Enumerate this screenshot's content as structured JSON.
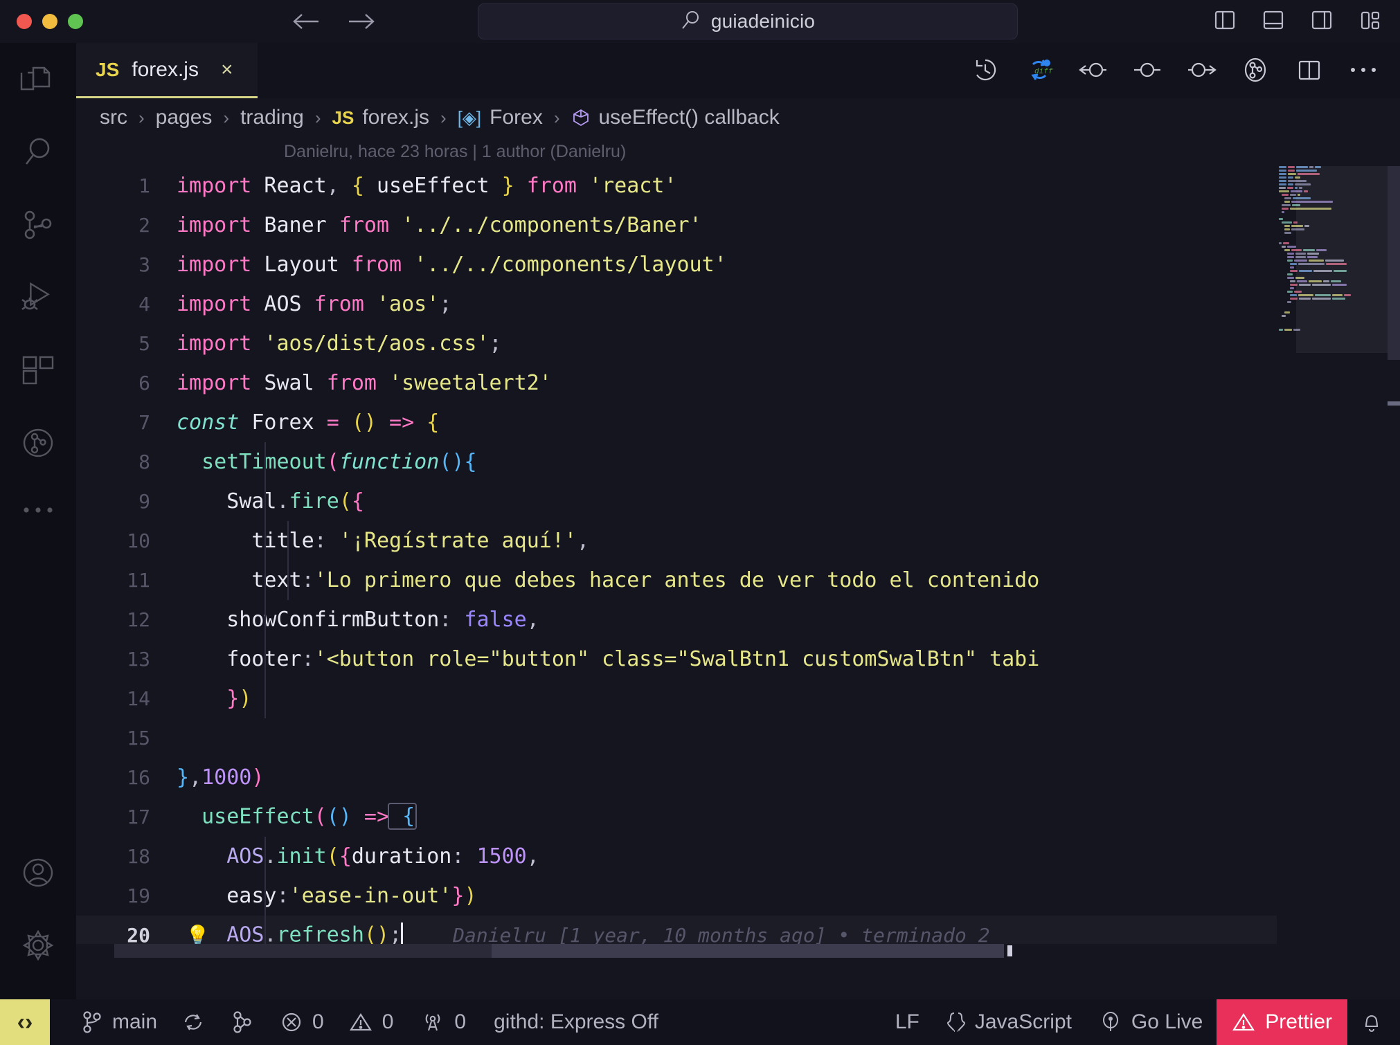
{
  "titlebar": {
    "search_value": "guiadeinicio",
    "search_icon": "search-icon",
    "back_icon": "arrow-left-icon",
    "forward_icon": "arrow-right-icon",
    "layout_buttons": [
      {
        "name": "toggle-primary-sidebar-icon"
      },
      {
        "name": "toggle-panel-icon"
      },
      {
        "name": "toggle-secondary-sidebar-icon"
      },
      {
        "name": "customize-layout-icon"
      }
    ]
  },
  "activitybar": {
    "items": [
      {
        "name": "explorer-icon",
        "label": "Explorer"
      },
      {
        "name": "search-icon",
        "label": "Search"
      },
      {
        "name": "source-control-icon",
        "label": "Source Control"
      },
      {
        "name": "run-and-debug-icon",
        "label": "Run and Debug"
      },
      {
        "name": "extensions-icon",
        "label": "Extensions"
      },
      {
        "name": "git-graph-icon",
        "label": "Git Graph"
      },
      {
        "name": "more-icon",
        "label": "Additional Views"
      }
    ],
    "bottom_items": [
      {
        "name": "accounts-icon",
        "label": "Accounts"
      },
      {
        "name": "settings-gear-icon",
        "label": "Manage"
      }
    ]
  },
  "tab": {
    "icon_label": "JS",
    "filename": "forex.js",
    "close_label": "×"
  },
  "editor_actions": [
    {
      "name": "timeline-history-icon"
    },
    {
      "name": "git-diff-icon"
    },
    {
      "name": "previous-change-icon"
    },
    {
      "name": "current-change-icon"
    },
    {
      "name": "next-change-icon"
    },
    {
      "name": "git-blame-toggle-icon"
    },
    {
      "name": "split-editor-icon"
    },
    {
      "name": "more-actions-icon"
    }
  ],
  "breadcrumb": {
    "items": [
      {
        "label": "src",
        "icon": null
      },
      {
        "label": "pages",
        "icon": null
      },
      {
        "label": "trading",
        "icon": null
      },
      {
        "label": "forex.js",
        "icon": "js-file-icon"
      },
      {
        "label": "Forex",
        "icon": "symbol-variable-icon"
      },
      {
        "label": "useEffect() callback",
        "icon": "symbol-function-icon"
      }
    ],
    "separator": "›"
  },
  "blame_header": "Danielru, hace 23 horas | 1 author (Danielru)",
  "editor": {
    "current_line": 20,
    "inline_blame": "Danielru [1 year, 10 months ago] • terminado 2",
    "lightbulb_icon": "lightbulb-icon",
    "lines": [
      {
        "n": 1,
        "tokens": [
          [
            "t-kw",
            "import"
          ],
          [
            "t-var",
            " React"
          ],
          [
            "t-punc",
            ","
          ],
          [
            "t-b1",
            " {"
          ],
          [
            "t-var",
            " useEffect "
          ],
          [
            "t-b1",
            "}"
          ],
          [
            "t-kw",
            " from"
          ],
          [
            "t-str",
            " 'react'"
          ]
        ]
      },
      {
        "n": 2,
        "tokens": [
          [
            "t-kw",
            "import"
          ],
          [
            "t-var",
            " Baner"
          ],
          [
            "t-kw",
            " from"
          ],
          [
            "t-str",
            " '../../components/Baner'"
          ]
        ]
      },
      {
        "n": 3,
        "tokens": [
          [
            "t-kw",
            "import"
          ],
          [
            "t-var",
            " Layout"
          ],
          [
            "t-kw",
            " from"
          ],
          [
            "t-str",
            " '../../components/layout'"
          ]
        ]
      },
      {
        "n": 4,
        "tokens": [
          [
            "t-kw",
            "import"
          ],
          [
            "t-var",
            " AOS"
          ],
          [
            "t-kw",
            " from"
          ],
          [
            "t-str",
            " 'aos'"
          ],
          [
            "t-punc",
            ";"
          ]
        ]
      },
      {
        "n": 5,
        "tokens": [
          [
            "t-kw",
            "import"
          ],
          [
            "t-str",
            " 'aos/dist/aos.css'"
          ],
          [
            "t-punc",
            ";"
          ]
        ]
      },
      {
        "n": 6,
        "tokens": [
          [
            "t-kw",
            "import"
          ],
          [
            "t-var",
            " Swal"
          ],
          [
            "t-kw",
            " from"
          ],
          [
            "t-str",
            " 'sweetalert2'"
          ]
        ]
      },
      {
        "n": 7,
        "tokens": [
          [
            "t-kw2",
            "const"
          ],
          [
            "t-var",
            " Forex "
          ],
          [
            "t-kw",
            "="
          ],
          [
            "t-b1",
            " ()"
          ],
          [
            "t-kw",
            " =>"
          ],
          [
            "t-b1",
            " {"
          ]
        ]
      },
      {
        "n": 8,
        "tokens": [
          [
            "t-fn",
            "  setTimeout"
          ],
          [
            "t-b2",
            "("
          ],
          [
            "t-fnit",
            "function"
          ],
          [
            "t-b3",
            "()"
          ],
          [
            "t-b3",
            "{"
          ]
        ]
      },
      {
        "n": 9,
        "tokens": [
          [
            "t-var",
            "    Swal"
          ],
          [
            "t-punc",
            "."
          ],
          [
            "t-fn",
            "fire"
          ],
          [
            "t-b1",
            "("
          ],
          [
            "t-b2",
            "{"
          ]
        ]
      },
      {
        "n": 10,
        "tokens": [
          [
            "t-prop",
            "      title"
          ],
          [
            "t-punc",
            ": "
          ],
          [
            "t-str",
            "'¡Regístrate aquí!'"
          ],
          [
            "t-punc",
            ","
          ]
        ]
      },
      {
        "n": 11,
        "tokens": [
          [
            "t-prop",
            "      text"
          ],
          [
            "t-punc",
            ":"
          ],
          [
            "t-str",
            "'Lo primero que debes hacer antes de ver todo el contenido"
          ]
        ]
      },
      {
        "n": 12,
        "tokens": [
          [
            "t-prop",
            "    showConfirmButton"
          ],
          [
            "t-punc",
            ": "
          ],
          [
            "t-bool",
            "false"
          ],
          [
            "t-punc",
            ","
          ]
        ]
      },
      {
        "n": 13,
        "tokens": [
          [
            "t-prop",
            "    footer"
          ],
          [
            "t-punc",
            ":"
          ],
          [
            "t-str",
            "'<button role=\"button\" class=\"SwalBtn1 customSwalBtn\" tabi"
          ]
        ]
      },
      {
        "n": 14,
        "tokens": [
          [
            "t-b2",
            "    }"
          ],
          [
            "t-b1",
            ")"
          ]
        ]
      },
      {
        "n": 15,
        "tokens": []
      },
      {
        "n": 16,
        "tokens": [
          [
            "t-b3",
            "}"
          ],
          [
            "t-punc",
            ","
          ],
          [
            "t-num",
            "1000"
          ],
          [
            "t-b2",
            ")"
          ]
        ]
      },
      {
        "n": 17,
        "tokens": [
          [
            "t-fn",
            "  useEffect"
          ],
          [
            "t-b2",
            "("
          ],
          [
            "t-b3",
            "()"
          ],
          [
            "t-kw",
            " =>"
          ],
          [
            "t-bracket",
            " {"
          ]
        ]
      },
      {
        "n": 18,
        "tokens": [
          [
            "t-obj",
            "    AOS"
          ],
          [
            "t-punc",
            "."
          ],
          [
            "t-fn",
            "init"
          ],
          [
            "t-b1",
            "("
          ],
          [
            "t-b2",
            "{"
          ],
          [
            "t-prop",
            "duration"
          ],
          [
            "t-punc",
            ": "
          ],
          [
            "t-num",
            "1500"
          ],
          [
            "t-punc",
            ","
          ]
        ]
      },
      {
        "n": 19,
        "tokens": [
          [
            "t-prop",
            "    easy"
          ],
          [
            "t-punc",
            ":"
          ],
          [
            "t-str",
            "'ease-in-out'"
          ],
          [
            "t-b2",
            "}"
          ],
          [
            "t-b1",
            ")"
          ]
        ]
      },
      {
        "n": 20,
        "tokens": [
          [
            "t-obj",
            "    AOS"
          ],
          [
            "t-punc",
            "."
          ],
          [
            "t-fn",
            "refresh"
          ],
          [
            "t-b1",
            "()"
          ],
          [
            "t-punc",
            ";"
          ]
        ]
      }
    ]
  },
  "statusbar": {
    "remote_icon": "remote-window-icon",
    "left_items": [
      {
        "name": "status-branch",
        "icon": "source-control-branch-icon",
        "label": "main"
      },
      {
        "name": "status-sync",
        "icon": "sync-icon",
        "label": ""
      },
      {
        "name": "status-git-fork",
        "icon": "git-fork-icon",
        "label": ""
      },
      {
        "name": "status-errors",
        "icon": "error-circle-icon",
        "label": "0"
      },
      {
        "name": "status-warnings",
        "icon": "warning-triangle-icon",
        "label": "0"
      },
      {
        "name": "status-ports",
        "icon": "radio-tower-icon",
        "label": "0"
      },
      {
        "name": "status-githd",
        "icon": null,
        "label": "githd: Express Off"
      }
    ],
    "right_items": [
      {
        "name": "status-eol",
        "icon": null,
        "label": "LF"
      },
      {
        "name": "status-language",
        "icon": "braces-icon",
        "label": "JavaScript"
      },
      {
        "name": "status-go-live",
        "icon": "broadcast-icon",
        "label": "Go Live"
      },
      {
        "name": "status-prettier",
        "icon": "warning-triangle-icon",
        "label": "Prettier"
      },
      {
        "name": "status-notifications",
        "icon": "bell-icon",
        "label": ""
      }
    ]
  },
  "colors": {
    "editor_bg": "#15151f",
    "titlebar_bg": "#14141f",
    "activitybar_bg": "#0e0e16",
    "tab_active_border": "#d7d787",
    "js_yellow": "#e8d44d",
    "prettier_bg": "#e8305a",
    "remote_bg": "#e2dd7d",
    "string": "#e6e68a",
    "keyword": "#ff79c6",
    "number": "#bd93f9",
    "function": "#7fe0c0"
  }
}
